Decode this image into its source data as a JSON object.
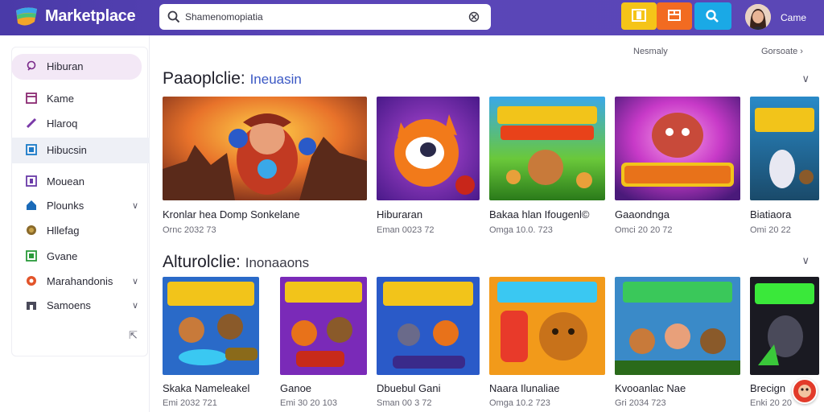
{
  "header": {
    "brand": "Marketplace",
    "search_placeholder": "Shamenomopiatia",
    "user_name": "Came",
    "colors": {
      "bar": "#5a45b8",
      "btn1": "#f5c418",
      "btn2": "#f26b21",
      "btn3": "#1aa9e6"
    }
  },
  "sidebar": {
    "items": [
      {
        "label": "Hiburan",
        "icon": "heart-icon"
      },
      {
        "label": "Kame",
        "icon": "window-icon"
      },
      {
        "label": "Hlaroq",
        "icon": "pen-icon"
      },
      {
        "label": "Hibucsin",
        "icon": "grid-icon"
      },
      {
        "label": "Mouean",
        "icon": "square-icon"
      },
      {
        "label": "Plounks",
        "icon": "home-icon"
      },
      {
        "label": "Hllefag",
        "icon": "globe-icon"
      },
      {
        "label": "Gvane",
        "icon": "box-icon"
      },
      {
        "label": "Marahandonis",
        "icon": "circle-icon"
      },
      {
        "label": "Samoens",
        "icon": "shop-icon"
      }
    ]
  },
  "main": {
    "links": {
      "left": "Nesmaly",
      "right": "Gorsoate"
    },
    "sections": [
      {
        "title": "Paaoplclie:",
        "subtitle": "Ineuasin",
        "cards": [
          {
            "title": "Kronlar hea Domp Sonkelane",
            "meta": "Ornc 2032 73"
          },
          {
            "title": "Hiburaran",
            "meta": "Eman 0023 72"
          },
          {
            "title": "Bakaa hlan Ifougenl©",
            "meta": "Omga 10.0. 723"
          },
          {
            "title": "Gaaondnga",
            "meta": "Omci 20 20 72"
          },
          {
            "title": "Biatiaora",
            "meta": "Omi 20 22"
          }
        ]
      },
      {
        "title": "Alturolclie:",
        "subtitle": "Inonaaons",
        "cards": [
          {
            "title": "Skaka Nameleakel",
            "meta": "Emi 2032 721"
          },
          {
            "title": "Ganoe",
            "meta": "Emi 30 20 103"
          },
          {
            "title": "Dbuebul Gani",
            "meta": "Sman 00 3 72"
          },
          {
            "title": "Naara Ilunaliae",
            "meta": "Omga 10.2 723"
          },
          {
            "title": "Kvooanlac Nae",
            "meta": "Gri 2034 723"
          },
          {
            "title": "Brecign",
            "meta": "Enki 20 20"
          }
        ]
      }
    ]
  }
}
